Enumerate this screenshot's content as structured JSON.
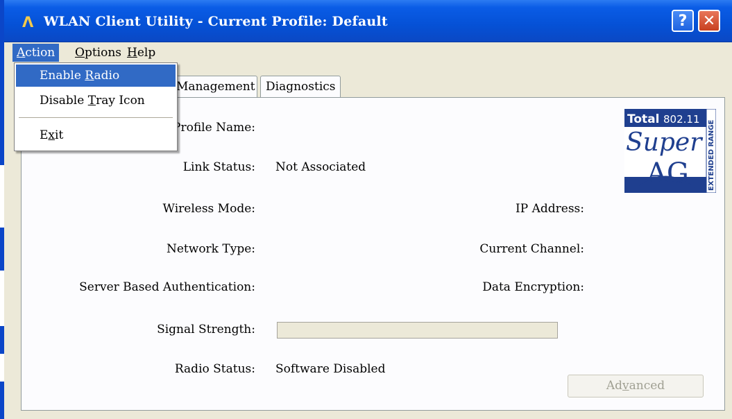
{
  "window": {
    "title": "WLAN Client Utility - Current Profile: Default",
    "app_glyph": "Λ",
    "help_glyph": "?",
    "close_glyph": "✕"
  },
  "menubar": {
    "items": [
      {
        "label": "Action",
        "accel": "A",
        "rest": "ction"
      },
      {
        "label": "Options",
        "accel": "O",
        "rest": "ptions"
      },
      {
        "label": "Help",
        "accel": "H",
        "rest": "elp"
      }
    ]
  },
  "action_menu": {
    "enable_radio": {
      "pre": "Enable ",
      "accel": "R",
      "post": "adio"
    },
    "disable_tray": {
      "pre": "Disable ",
      "accel": "T",
      "post": "ray Icon"
    },
    "exit": {
      "pre": "E",
      "accel": "x",
      "post": "it"
    }
  },
  "tabs": {
    "management": "Management",
    "diagnostics": "Diagnostics"
  },
  "status": {
    "profile_name_label": "Profile Name:",
    "profile_name_value": "",
    "link_status_label": "Link Status:",
    "link_status_value": "Not Associated",
    "wireless_mode_label": "Wireless Mode:",
    "wireless_mode_value": "",
    "network_type_label": "Network Type:",
    "network_type_value": "",
    "server_auth_label": "Server Based Authentication:",
    "server_auth_value": "",
    "signal_strength_label": "Signal Strength:",
    "signal_strength_fraction": 0,
    "radio_status_label": "Radio Status:",
    "radio_status_value": "Software Disabled",
    "ip_address_label": "IP Address:",
    "ip_address_value": "",
    "current_channel_label": "Current Channel:",
    "current_channel_value": "",
    "data_encryption_label": "Data Encryption:",
    "data_encryption_value": ""
  },
  "buttons": {
    "advanced": {
      "pre": "Ad",
      "accel": "v",
      "post": "anced",
      "enabled": false
    }
  },
  "logo": {
    "total": "Total",
    "standard": "802.11",
    "super": "Super",
    "ag": "AG",
    "extended": "EXTENDED RANGE"
  },
  "colors": {
    "titlebar": "#0551d6",
    "menu_highlight": "#316ac5",
    "window_bg": "#ece9d8",
    "panel_bg": "#fcfcfe",
    "logo_blue": "#1f3f8f"
  }
}
